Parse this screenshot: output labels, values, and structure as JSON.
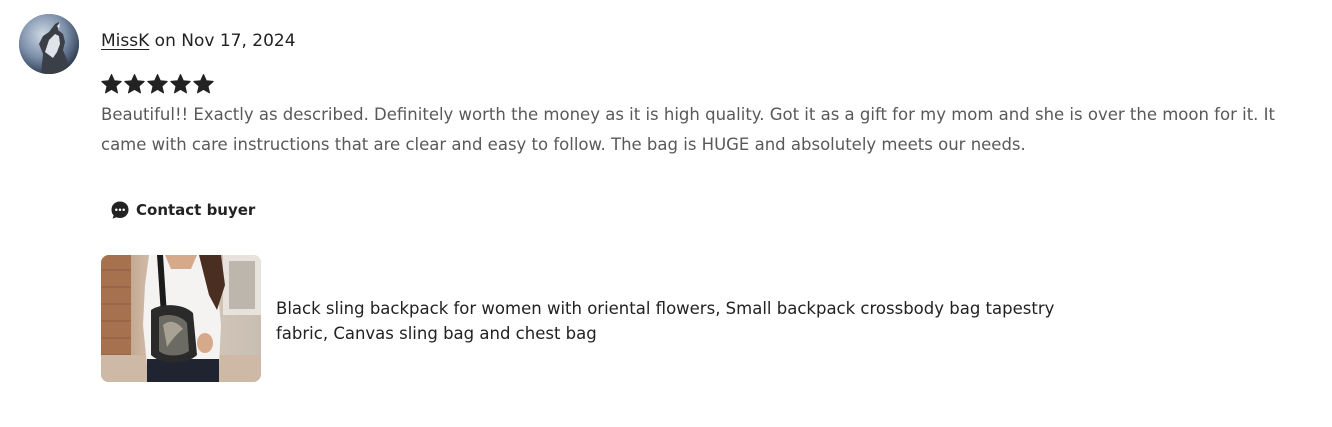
{
  "review": {
    "reviewer_name": "MissK",
    "date_text": " on Nov 17, 2024",
    "rating": 5,
    "rating_max": 5,
    "text": "Beautiful!! Exactly as described. Definitely worth the money as it is high quality. Got it as a gift for my mom and she is over the moon for it. It came with care instructions that are clear and easy to follow. The bag is HUGE and absolutely meets our needs."
  },
  "actions": {
    "contact_label": "Contact buyer"
  },
  "product": {
    "title": "Black sling backpack for women with oriental flowers, Small backpack crossbody bag tapestry fabric, Canvas sling bag and chest bag"
  },
  "icons": {
    "avatar": "wolf-avatar-icon",
    "star": "star-icon",
    "contact": "chat-bubble-icon"
  },
  "colors": {
    "text_primary": "#222222",
    "text_secondary": "#595959",
    "star": "#222222"
  }
}
